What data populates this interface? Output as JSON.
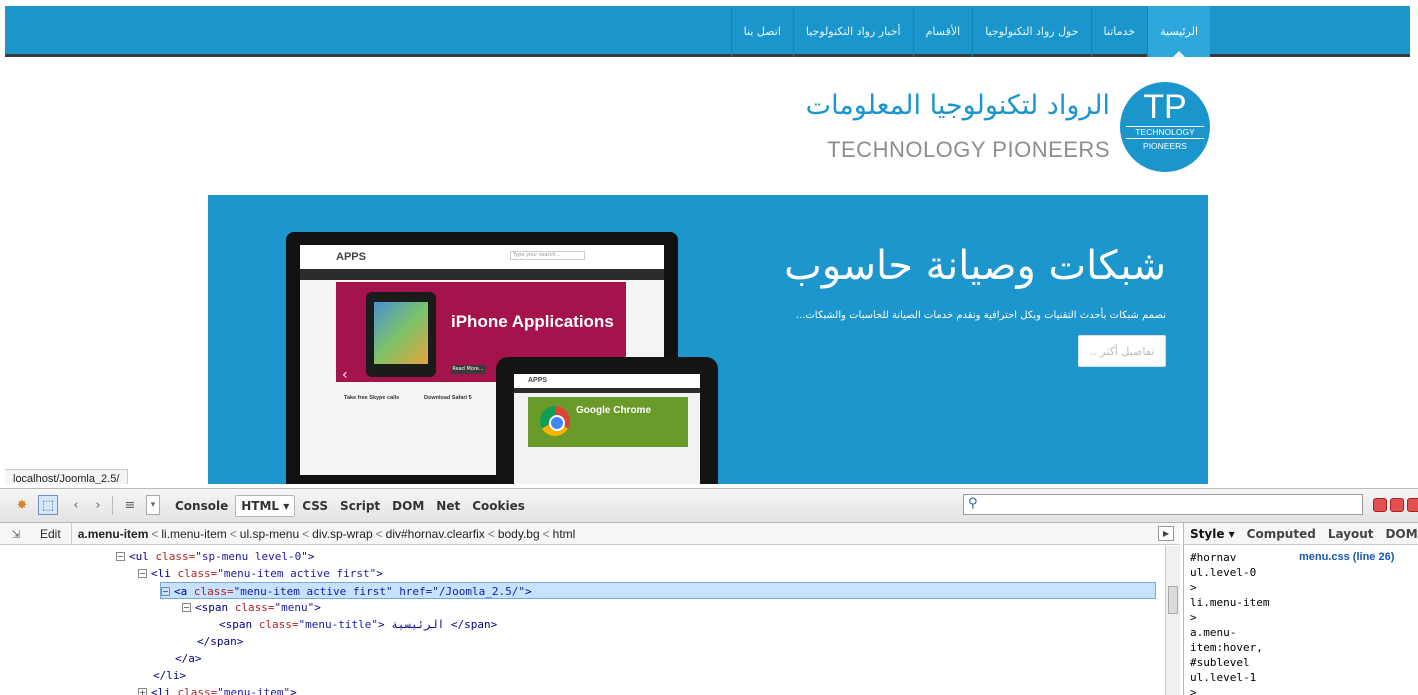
{
  "page": {
    "nav": {
      "items": [
        {
          "label": "الرئيسية",
          "active": true
        },
        {
          "label": "خدماتنا"
        },
        {
          "label": "حول رواد التكنولوجيا"
        },
        {
          "label": "الأقسام"
        },
        {
          "label": "أخبار رواد التكنولوجيا"
        },
        {
          "label": "اتصل بنا"
        }
      ]
    },
    "logo": {
      "arabic": "الرواد لتكنولوجيا المعلومات",
      "english": "TECHNOLOGY PIONEERS",
      "badge_letters": "TP",
      "badge_line1": "TECHNOLOGY",
      "badge_line2": "PIONEERS"
    },
    "slide": {
      "title": "شبكات وصيانة حاسوب",
      "description": "نصمم شبكات بأحدث التقنيات وبكل احترافية ونقدم خدمات الصيانة للحاسبات والشبكات...",
      "button": "تفاصيل أكثر ..",
      "mockup_brand": "APPS",
      "mockup_search": "Type your search...",
      "mockup_hero": "iPhone Applications",
      "mockup_read_more": "Read More...",
      "mockup_col1": "Take free Skype calls",
      "mockup_col2": "Download Safari 5",
      "ipad_brand": "APPS",
      "ipad_hero": "Google Chrome"
    },
    "status_url": "localhost/Joomla_2.5/"
  },
  "firebug": {
    "tabs": [
      "Console",
      "HTML ▾",
      "CSS",
      "Script",
      "DOM",
      "Net",
      "Cookies"
    ],
    "selected_tab": "HTML ▾",
    "search_placeholder": "",
    "breadcrumb": {
      "edit": "Edit",
      "items": [
        "a.menu-item",
        "li.menu-item",
        "ul.sp-menu",
        "div.sp-wrap",
        "div#hornav.clearfix",
        "body.bg",
        "html"
      ]
    },
    "html_lines": [
      {
        "toggle": "⊟",
        "indent": 1,
        "text_a": "<ul ",
        "attr": "class=",
        "val": "\"sp-menu level-0\"",
        "text_b": ">"
      },
      {
        "toggle": "⊟",
        "indent": 2,
        "text_a": "<li ",
        "attr": "class=",
        "val": "\"menu-item active first\"",
        "text_b": ">"
      },
      {
        "toggle": "⊟",
        "indent": 3,
        "text_a": "<a ",
        "attr": "class=",
        "val": "\"menu-item active first\" href=\"/Joomla_2.5/\"",
        "text_b": ">",
        "selected": true
      },
      {
        "toggle": "⊟",
        "indent": 4,
        "text_a": "<span ",
        "attr": "class=",
        "val": "\"menu\"",
        "text_b": ">"
      },
      {
        "toggle": "",
        "indent": 5,
        "text_a": "<span ",
        "attr": "class=",
        "val": "\"menu-title\"",
        "text_b": "> الرئيسية </span>"
      },
      {
        "toggle": "",
        "indent": 4,
        "text_a": "</span>",
        "attr": "",
        "val": "",
        "text_b": ""
      },
      {
        "toggle": "",
        "indent": 3,
        "text_a": "</a>",
        "attr": "",
        "val": "",
        "text_b": ""
      },
      {
        "toggle": "",
        "indent": 2,
        "text_a": "</li>",
        "attr": "",
        "val": "",
        "text_b": ""
      },
      {
        "toggle": "⊞",
        "indent": 2,
        "text_a": "<li ",
        "attr": "class=",
        "val": "\"menu-item\"",
        "text_b": ">"
      }
    ],
    "side_tabs": [
      "Style ▾",
      "Computed",
      "Layout",
      "DOM"
    ],
    "side_selected": "Style ▾",
    "style_source": "menu.css (line 26)",
    "style_lines": [
      "#hornav",
      "ul.level-0",
      ">",
      "li.menu-item",
      ">",
      "a.menu-",
      "item:hover,",
      "#sublevel",
      "ul.level-1",
      ">"
    ]
  }
}
